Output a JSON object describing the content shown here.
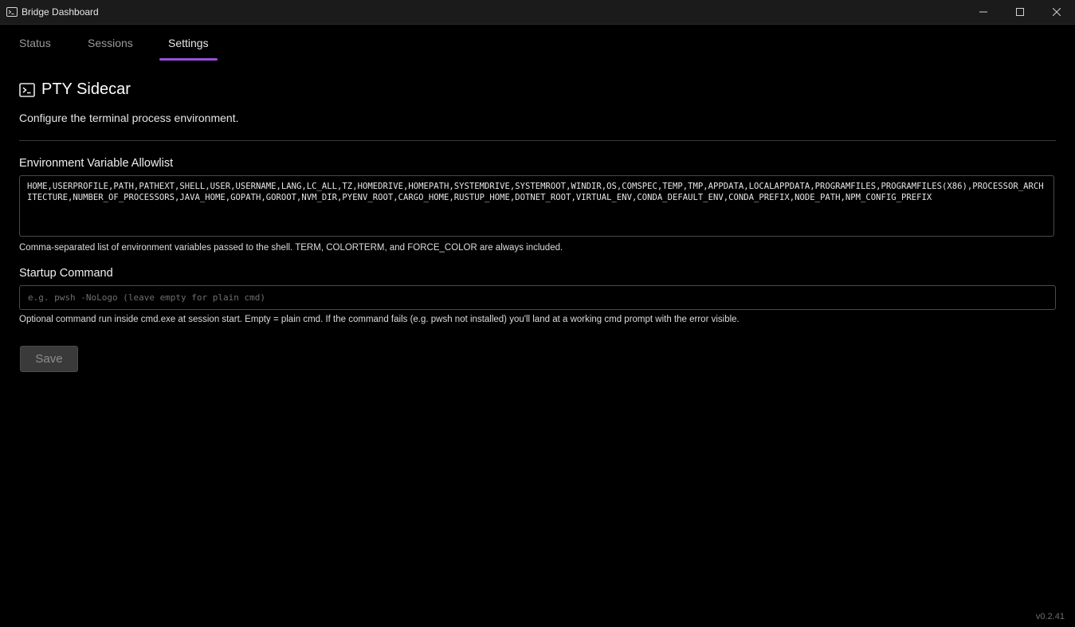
{
  "window": {
    "title": "Bridge Dashboard"
  },
  "tabs": [
    {
      "label": "Status"
    },
    {
      "label": "Sessions"
    },
    {
      "label": "Settings",
      "active": true
    }
  ],
  "section": {
    "icon": "terminal-icon",
    "title": "PTY Sidecar",
    "description": "Configure the terminal process environment."
  },
  "allowlist": {
    "label": "Environment Variable Allowlist",
    "value": "HOME,USERPROFILE,PATH,PATHEXT,SHELL,USER,USERNAME,LANG,LC_ALL,TZ,HOMEDRIVE,HOMEPATH,SYSTEMDRIVE,SYSTEMROOT,WINDIR,OS,COMSPEC,TEMP,TMP,APPDATA,LOCALAPPDATA,PROGRAMFILES,PROGRAMFILES(X86),PROCESSOR_ARCHITECTURE,NUMBER_OF_PROCESSORS,JAVA_HOME,GOPATH,GOROOT,NVM_DIR,PYENV_ROOT,CARGO_HOME,RUSTUP_HOME,DOTNET_ROOT,VIRTUAL_ENV,CONDA_DEFAULT_ENV,CONDA_PREFIX,NODE_PATH,NPM_CONFIG_PREFIX",
    "hint": "Comma-separated list of environment variables passed to the shell. TERM, COLORTERM, and FORCE_COLOR are always included."
  },
  "startup": {
    "label": "Startup Command",
    "value": "",
    "placeholder": "e.g. pwsh -NoLogo (leave empty for plain cmd)",
    "hint": "Optional command run inside cmd.exe at session start. Empty = plain cmd. If the command fails (e.g. pwsh not installed) you'll land at a working cmd prompt with the error visible."
  },
  "actions": {
    "save_label": "Save"
  },
  "footer": {
    "version": "v0.2.41"
  },
  "colors": {
    "accent": "#9b4de0",
    "background": "#000000",
    "titlebar": "#1b1b1b",
    "button_disabled": "#3a3a3a"
  }
}
